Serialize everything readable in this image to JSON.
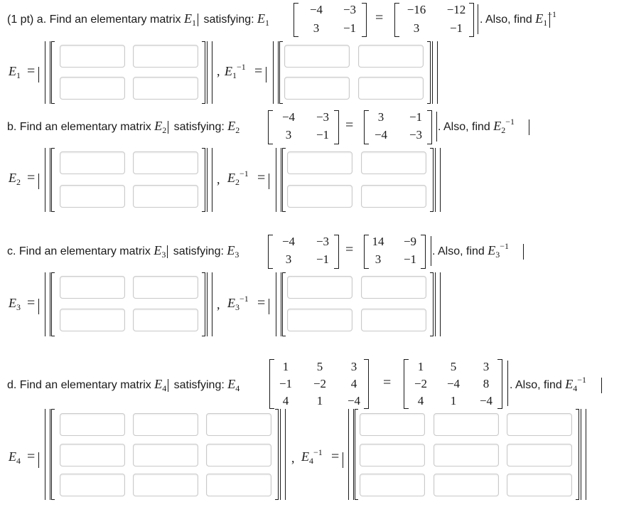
{
  "part_a": {
    "prefix": "(1 pt) a. Find an elementary matrix",
    "satisfying": "satisfying:",
    "also": ". Also, find",
    "E": "E",
    "sub": "1",
    "inv_sup": "−1",
    "lhs": [
      "−4",
      "−3",
      "3",
      "−1"
    ],
    "rhs": [
      "−16",
      "−12",
      "3",
      "−1"
    ]
  },
  "part_b": {
    "prefix": "b. Find an elementary matrix",
    "satisfying": "satisfying:",
    "also": ". Also, find",
    "E": "E",
    "sub": "2",
    "inv_sup": "−1",
    "lhs": [
      "−4",
      "−3",
      "3",
      "−1"
    ],
    "rhs": [
      "3",
      "−1",
      "−4",
      "−3"
    ]
  },
  "part_c": {
    "prefix": "c. Find an elementary matrix",
    "satisfying": "satisfying:",
    "also": ". Also, find",
    "E": "E",
    "sub": "3",
    "inv_sup": "−1",
    "lhs": [
      "−4",
      "−3",
      "3",
      "−1"
    ],
    "rhs": [
      "14",
      "−9",
      "3",
      "−1"
    ]
  },
  "part_d": {
    "prefix": "d. Find an elementary matrix",
    "satisfying": "satisfying:",
    "also": ". Also, find",
    "E": "E",
    "sub": "4",
    "inv_sup": "−1",
    "lhs": [
      "1",
      "5",
      "3",
      "−1",
      "−2",
      "4",
      "4",
      "1",
      "−4"
    ],
    "rhs": [
      "1",
      "5",
      "3",
      "−2",
      "−4",
      "8",
      "4",
      "1",
      "−4"
    ]
  },
  "symbols": {
    "equals": "=",
    "comma": ","
  }
}
